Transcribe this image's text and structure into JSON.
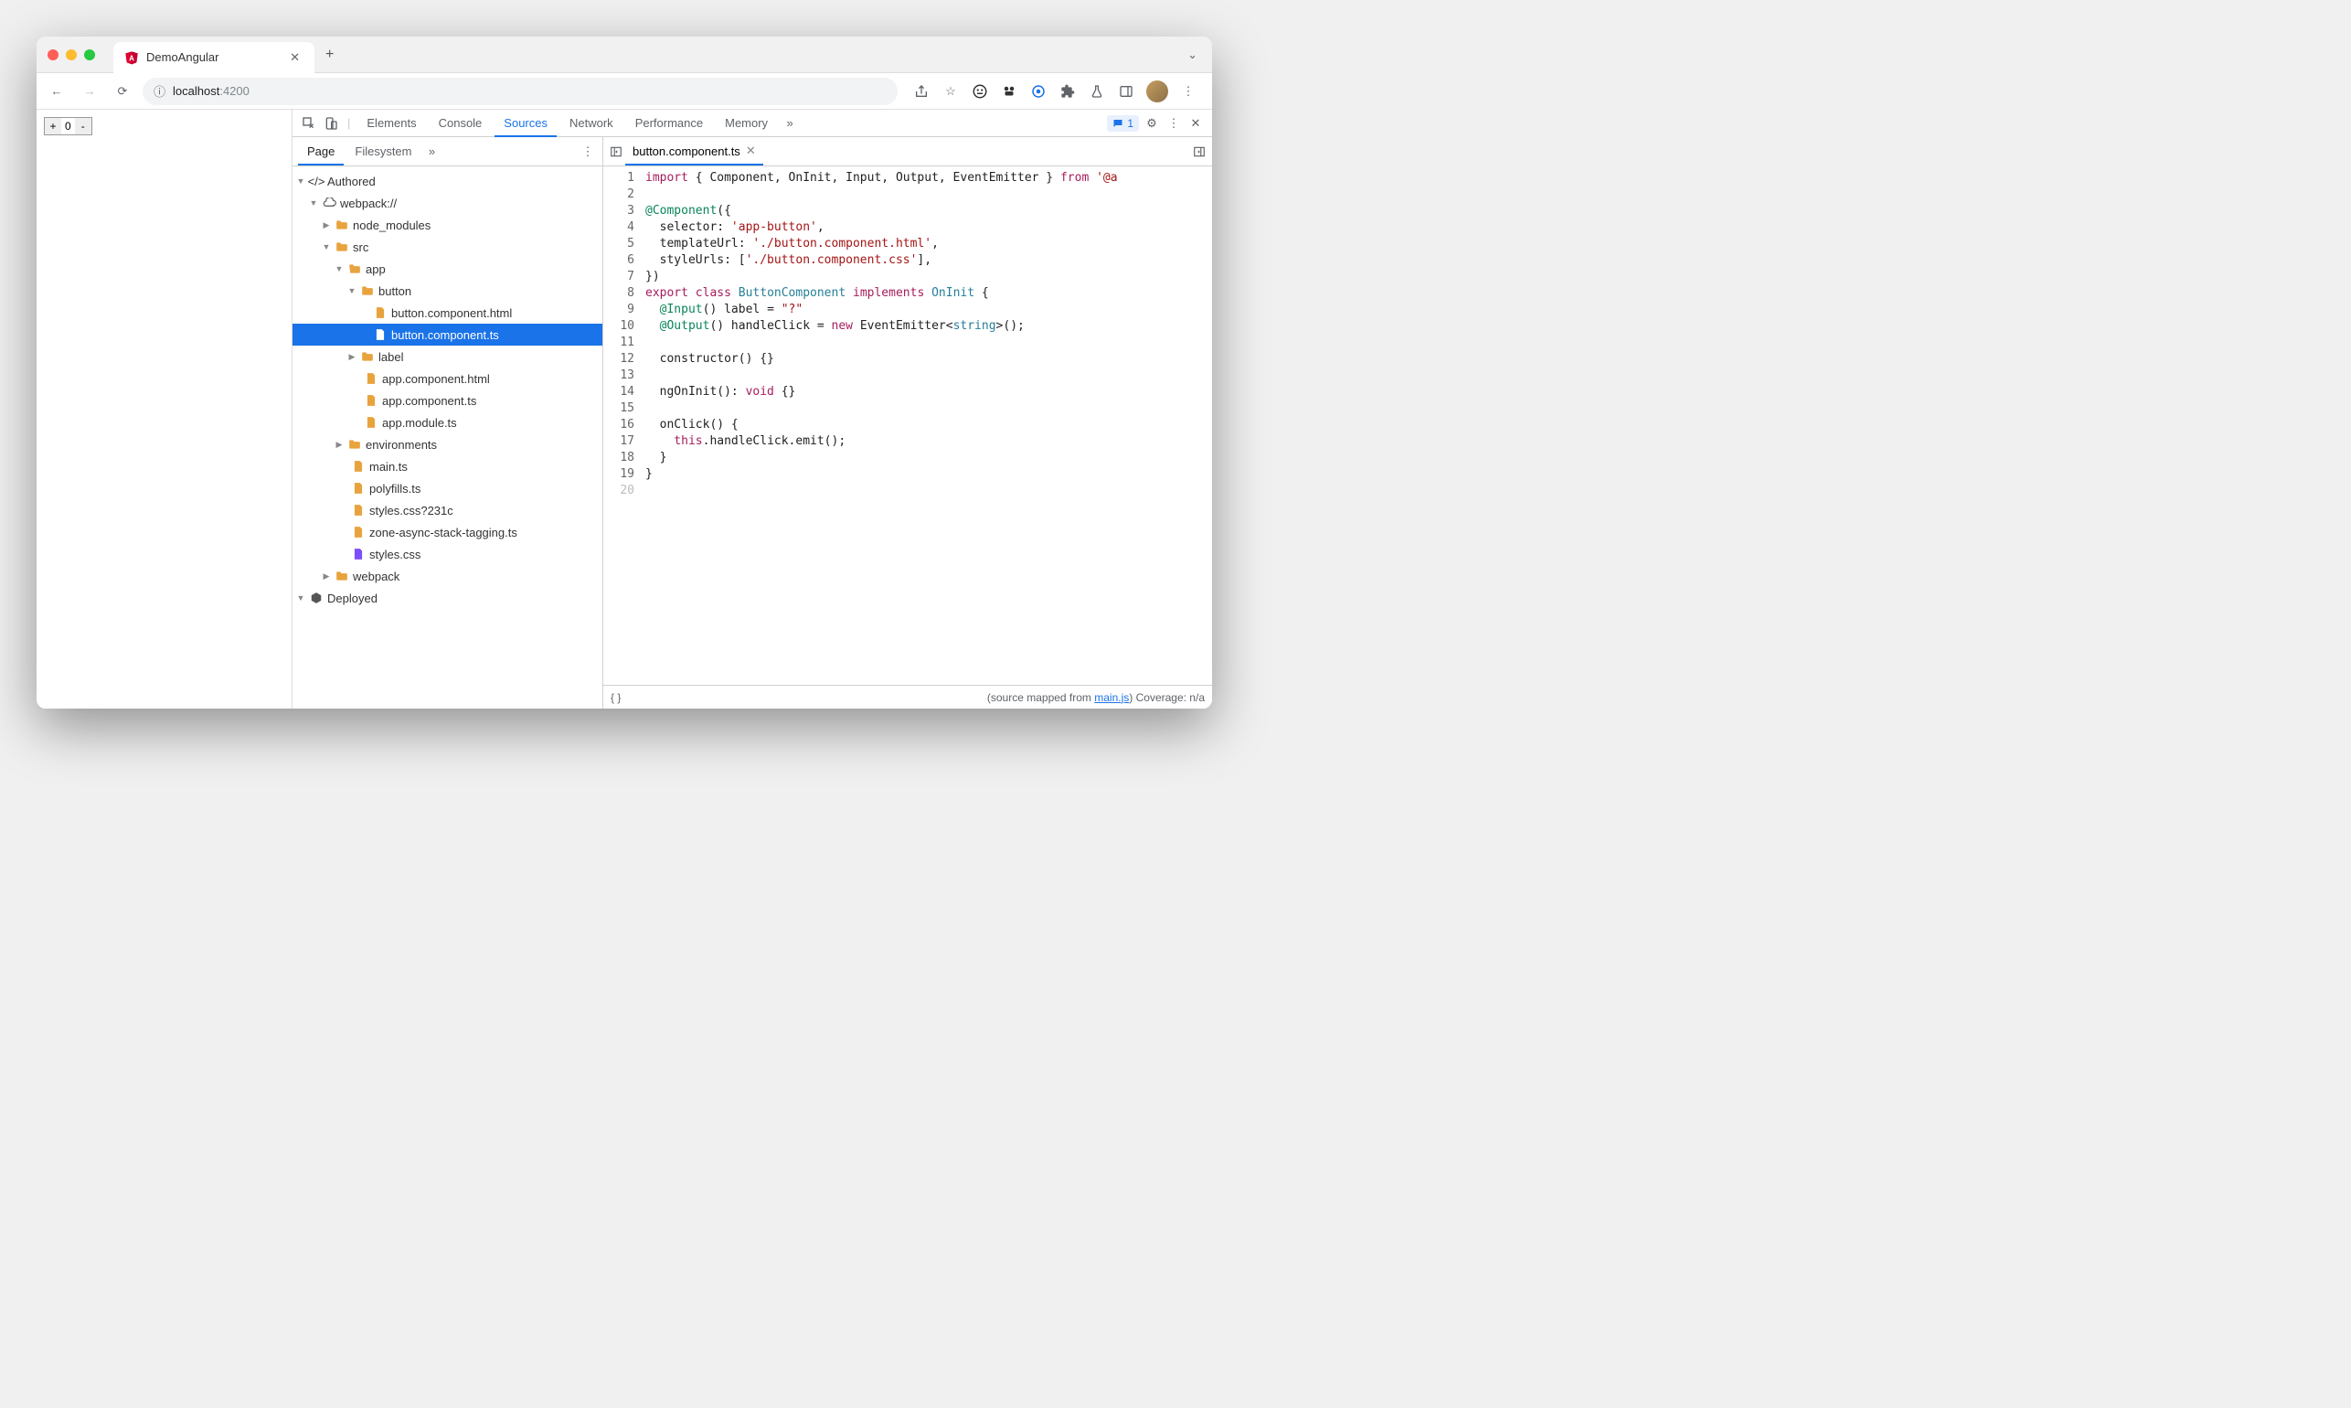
{
  "browser": {
    "tab_title": "DemoAngular",
    "url_host": "localhost",
    "url_port": ":4200"
  },
  "page": {
    "counter_value": "0",
    "plus": "+",
    "minus": "-"
  },
  "devtools": {
    "tabs": [
      "Elements",
      "Console",
      "Sources",
      "Network",
      "Performance",
      "Memory"
    ],
    "active_tab": "Sources",
    "issue_count": "1",
    "sources_subtabs": [
      "Page",
      "Filesystem"
    ],
    "active_subtab": "Page"
  },
  "tree": {
    "authored": "Authored",
    "webpack": "webpack://",
    "node_modules": "node_modules",
    "src": "src",
    "app": "app",
    "button": "button",
    "button_html": "button.component.html",
    "button_ts": "button.component.ts",
    "label_folder": "label",
    "app_html": "app.component.html",
    "app_ts": "app.component.ts",
    "app_module": "app.module.ts",
    "environments": "environments",
    "main_ts": "main.ts",
    "polyfills": "polyfills.ts",
    "styles_q": "styles.css?231c",
    "zone": "zone-async-stack-tagging.ts",
    "styles": "styles.css",
    "webpack_folder": "webpack",
    "deployed": "Deployed"
  },
  "editor": {
    "open_file": "button.component.ts",
    "lines": 20,
    "source_mapped": "(source mapped from ",
    "source_file": "main.js",
    "coverage": ")  Coverage: n/a",
    "code": {
      "l1_import": "import",
      "l1_braces": " { Component, OnInit, Input, Output, EventEmitter } ",
      "l1_from": "from",
      "l1_pkg": " '@a",
      "l3_dec": "@Component",
      "l3_open": "({",
      "l4_key": "  selector: ",
      "l4_val": "'app-button'",
      "l4_end": ",",
      "l5_key": "  templateUrl: ",
      "l5_val": "'./button.component.html'",
      "l5_end": ",",
      "l6_key": "  styleUrls: [",
      "l6_val": "'./button.component.css'",
      "l6_end": "],",
      "l7": "})",
      "l8_export": "export",
      "l8_class": " class ",
      "l8_name": "ButtonComponent",
      "l8_impl": " implements ",
      "l8_iface": "OnInit",
      "l8_open": " {",
      "l9_dec": "  @Input",
      "l9_rest": "() label = ",
      "l9_val": "\"?\"",
      "l10_dec": "  @Output",
      "l10_rest": "() handleClick = ",
      "l10_new": "new",
      "l10_emit": " EventEmitter<",
      "l10_type": "string",
      "l10_end": ">();",
      "l12": "  constructor() {}",
      "l14_fn": "  ngOnInit(): ",
      "l14_void": "void",
      "l14_end": " {}",
      "l16": "  onClick() {",
      "l17_this": "    this",
      "l17_rest": ".handleClick.emit();",
      "l18": "  }",
      "l19": "}"
    }
  }
}
